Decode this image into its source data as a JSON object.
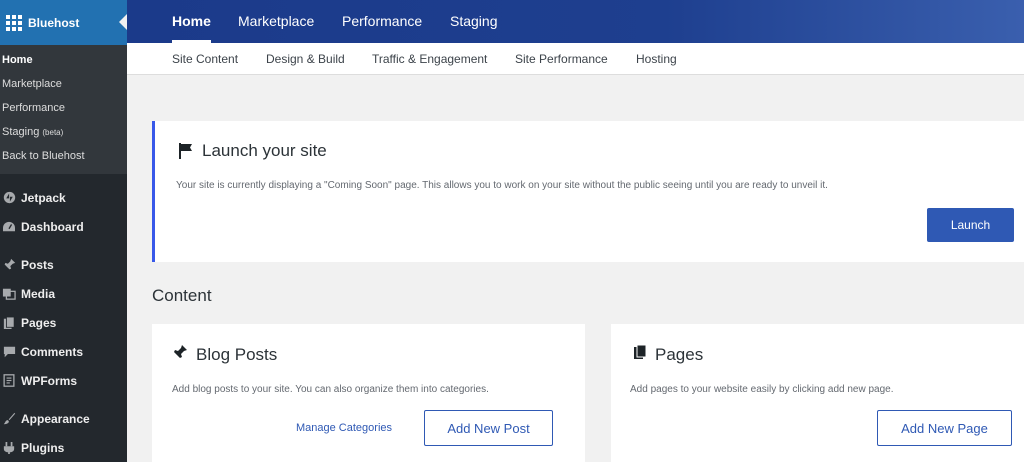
{
  "sidebar": {
    "title": "Bluehost",
    "sub_items": [
      {
        "label": "Home",
        "active": true
      },
      {
        "label": "Marketplace"
      },
      {
        "label": "Performance"
      },
      {
        "label": "Staging",
        "badge": "(beta)"
      },
      {
        "label": "Back to Bluehost"
      }
    ],
    "menu": [
      {
        "label": "Jetpack",
        "icon": "jetpack-icon"
      },
      {
        "label": "Dashboard",
        "icon": "dashboard-icon"
      },
      {
        "label": "Posts",
        "icon": "pin-icon"
      },
      {
        "label": "Media",
        "icon": "media-icon"
      },
      {
        "label": "Pages",
        "icon": "pages-icon"
      },
      {
        "label": "Comments",
        "icon": "comments-icon"
      },
      {
        "label": "WPForms",
        "icon": "wpforms-icon"
      },
      {
        "label": "Appearance",
        "icon": "brush-icon"
      },
      {
        "label": "Plugins",
        "icon": "plugin-icon"
      }
    ]
  },
  "topnav": {
    "tabs": [
      "Home",
      "Marketplace",
      "Performance",
      "Staging"
    ],
    "active": "Home"
  },
  "subnav": {
    "items": [
      "Site Content",
      "Design & Build",
      "Traffic & Engagement",
      "Site Performance",
      "Hosting"
    ]
  },
  "launch": {
    "title": "Launch your site",
    "description": "Your site is currently displaying a \"Coming Soon\" page. This allows you to work on your site without the public seeing until you are ready to unveil it.",
    "button": "Launch"
  },
  "content": {
    "heading": "Content",
    "blog": {
      "title": "Blog Posts",
      "description": "Add blog posts to your site. You can also organize them into categories.",
      "link": "Manage Categories",
      "button": "Add New Post"
    },
    "pages": {
      "title": "Pages",
      "description": "Add pages to your website easily by clicking add new page.",
      "button": "Add New Page"
    }
  },
  "colors": {
    "accent": "#2f59b4",
    "topbar": "#1e3f8f",
    "sidebar": "#23282d"
  }
}
